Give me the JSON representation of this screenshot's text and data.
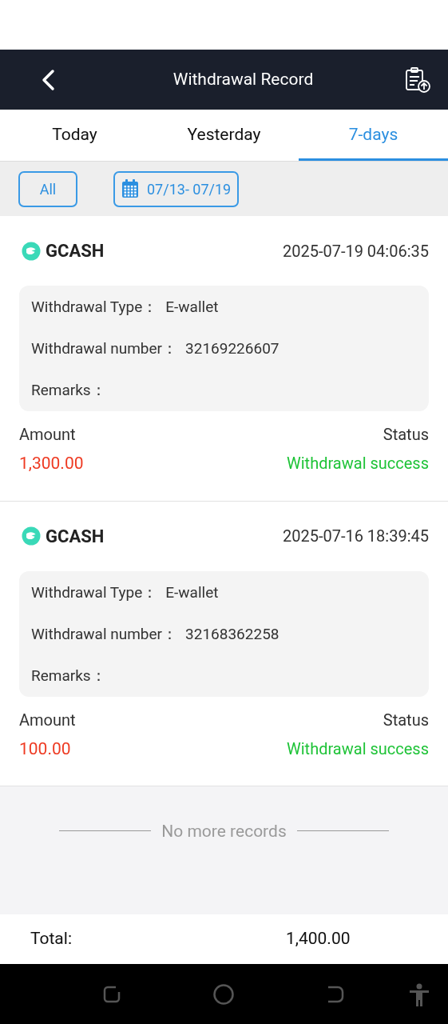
{
  "header": {
    "title": "Withdrawal Record"
  },
  "tabs": [
    {
      "label": "Today",
      "selected": false
    },
    {
      "label": "Yesterday",
      "selected": false
    },
    {
      "label": "7-days",
      "selected": true
    }
  ],
  "filters": {
    "all": "All",
    "date_range": "07/13- 07/19"
  },
  "records": [
    {
      "method": "GCASH",
      "time": "2025-07-19 04:06:35",
      "fields": [
        {
          "label": "Withdrawal Type：",
          "value": "E-wallet"
        },
        {
          "label": "Withdrawal number：",
          "value": "32169226607"
        },
        {
          "label": "Remarks："
        }
      ],
      "amount_label": "Amount",
      "amount": "1,300.00",
      "status_label": "Status",
      "status": "Withdrawal success"
    },
    {
      "method": "GCASH",
      "time": "2025-07-16 18:39:45",
      "fields": [
        {
          "label": "Withdrawal Type：",
          "value": "E-wallet"
        },
        {
          "label": "Withdrawal number：",
          "value": "32168362258"
        },
        {
          "label": "Remarks："
        }
      ],
      "amount_label": "Amount",
      "amount": "100.00",
      "status_label": "Status",
      "status": "Withdrawal success"
    }
  ],
  "end_note": "No more records",
  "footer": {
    "label": "Total:",
    "value": "1,400.00"
  }
}
